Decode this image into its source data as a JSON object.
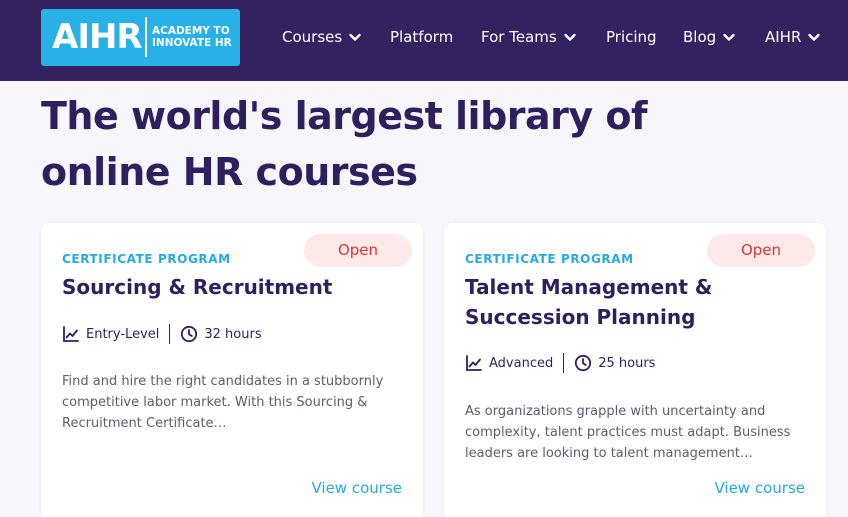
{
  "header": {
    "logo": {
      "mark": "AIHR",
      "tagline": "ACADEMY TO INNOVATE HR"
    },
    "nav": [
      {
        "label": "Courses",
        "dropdown": true
      },
      {
        "label": "Platform",
        "dropdown": false
      },
      {
        "label": "For Teams",
        "dropdown": true
      },
      {
        "label": "Pricing",
        "dropdown": false
      },
      {
        "label": "Blog",
        "dropdown": true
      },
      {
        "label": "AIHR",
        "dropdown": true
      }
    ]
  },
  "page": {
    "heading": "The world's largest library of online HR courses"
  },
  "courses": [
    {
      "badge": "Open",
      "eyebrow": "CERTIFICATE PROGRAM",
      "title": "Sourcing & Recruitment",
      "level": "Entry-Level",
      "duration": "32 hours",
      "description": "Find and hire the right candidates in a stubbornly competitive labor market. With this Sourcing & Recruitment Certificate…",
      "cta": "View course"
    },
    {
      "badge": "Open",
      "eyebrow": "CERTIFICATE PROGRAM",
      "title": "Talent Management & Succession Planning",
      "level": "Advanced",
      "duration": "25 hours",
      "description": "As organizations grapple with uncertainty and complexity, talent practices must adapt. Business leaders are looking to talent management…",
      "cta": "View course"
    }
  ],
  "colors": {
    "nav_bg": "#33225f",
    "logo_bg": "#27b1e6",
    "accent": "#27a9e1",
    "heading": "#2e1f5e",
    "badge_bg": "#fde9e8",
    "badge_text": "#d6363c",
    "page_bg": "#f7f6fb"
  },
  "icons": {
    "nav_dropdown": "chevron-down-icon",
    "level": "trend-chart-icon",
    "duration": "clock-icon"
  }
}
